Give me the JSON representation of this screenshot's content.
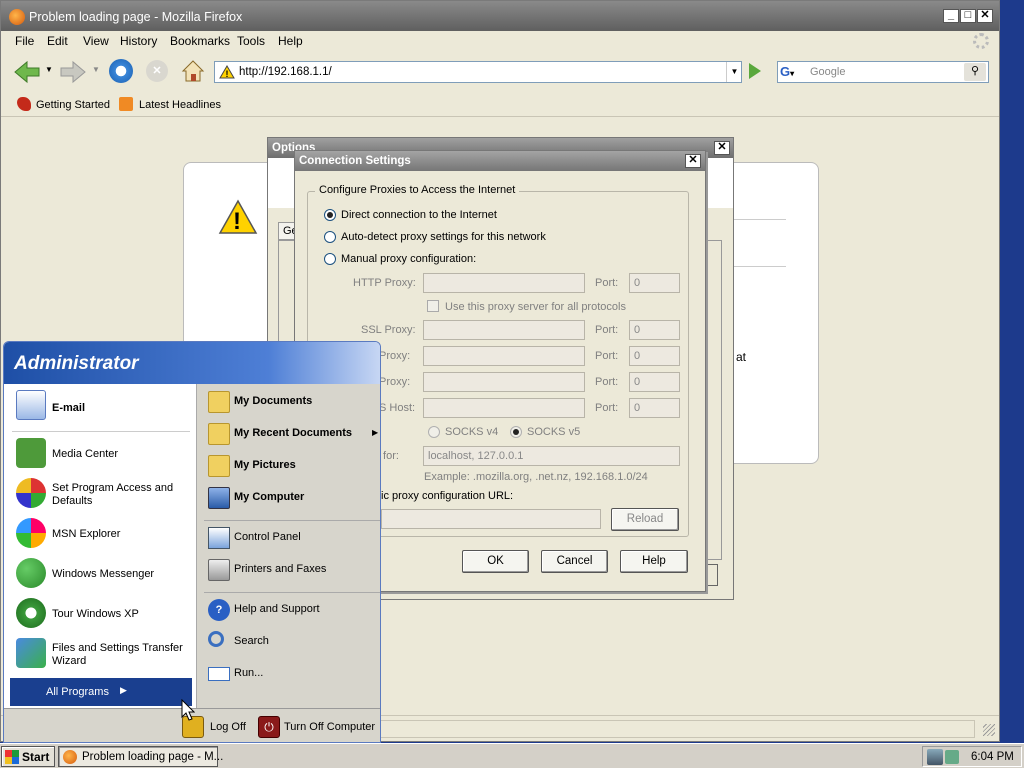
{
  "firefox": {
    "title": "Problem loading page - Mozilla Firefox",
    "menu": [
      "File",
      "Edit",
      "View",
      "History",
      "Bookmarks",
      "Tools",
      "Help"
    ],
    "address": "http://192.168.1.1/",
    "search_placeholder": "Google",
    "bookmarks": [
      "Getting Started",
      "Latest Headlines"
    ],
    "bg_text": "at"
  },
  "options": {
    "title": "Options",
    "tab_label": "Ge"
  },
  "connection": {
    "title": "Connection Settings",
    "group_label": "Configure Proxies to Access the Internet",
    "radio_direct": "Direct connection to the Internet",
    "radio_auto": "Auto-detect proxy settings for this network",
    "radio_manual": "Manual proxy configuration:",
    "http_proxy": "HTTP Proxy:",
    "port": "Port:",
    "port_value": "0",
    "use_same": "Use this proxy server for all protocols",
    "ssl_proxy": "SSL Proxy:",
    "ftp_proxy": "Proxy:",
    "gopher_proxy": "Proxy:",
    "socks_host": "S Host:",
    "socks_v4": "SOCKS v4",
    "socks_v5": "SOCKS v5",
    "no_proxy_label": "xy for:",
    "no_proxy_value": "localhost, 127.0.0.1",
    "example": "Example: .mozilla.org, .net.nz, 192.168.1.0/24",
    "auto_url_label": "ic proxy configuration URL:",
    "reload": "Reload",
    "ok": "OK",
    "cancel": "Cancel",
    "help": "Help"
  },
  "start_menu": {
    "user": "Administrator",
    "pinned": [
      {
        "label": "E-mail",
        "icon": "email-icon"
      }
    ],
    "recent": [
      {
        "label": "Media Center",
        "icon": "media-center-icon"
      },
      {
        "label": "Set Program Access and Defaults",
        "icon": "program-access-icon"
      },
      {
        "label": "MSN Explorer",
        "icon": "msn-icon"
      },
      {
        "label": "Windows Messenger",
        "icon": "messenger-icon"
      },
      {
        "label": "Tour Windows XP",
        "icon": "tour-icon"
      },
      {
        "label": "Files and Settings Transfer Wizard",
        "icon": "transfer-wizard-icon"
      }
    ],
    "all_programs": "All Programs",
    "right_bold": [
      {
        "label": "My Documents",
        "icon": "folder-icon"
      },
      {
        "label": "My Recent Documents",
        "icon": "folder-icon"
      },
      {
        "label": "My Pictures",
        "icon": "folder-icon"
      },
      {
        "label": "My Computer",
        "icon": "computer-icon"
      }
    ],
    "right_normal": [
      {
        "label": "Control Panel",
        "icon": "control-panel-icon"
      },
      {
        "label": "Printers and Faxes",
        "icon": "printer-icon"
      },
      {
        "label": "Help and Support",
        "icon": "help-icon"
      },
      {
        "label": "Search",
        "icon": "search-icon"
      },
      {
        "label": "Run...",
        "icon": "run-icon"
      }
    ],
    "log_off": "Log Off",
    "turn_off": "Turn Off Computer"
  },
  "taskbar": {
    "start": "Start",
    "task": "Problem loading page - M...",
    "clock": "6:04 PM"
  },
  "colors": {
    "titlebar": "#6b6b6b",
    "start_header": "#1e4fa6",
    "all_programs_bg": "#1a3f8f"
  }
}
